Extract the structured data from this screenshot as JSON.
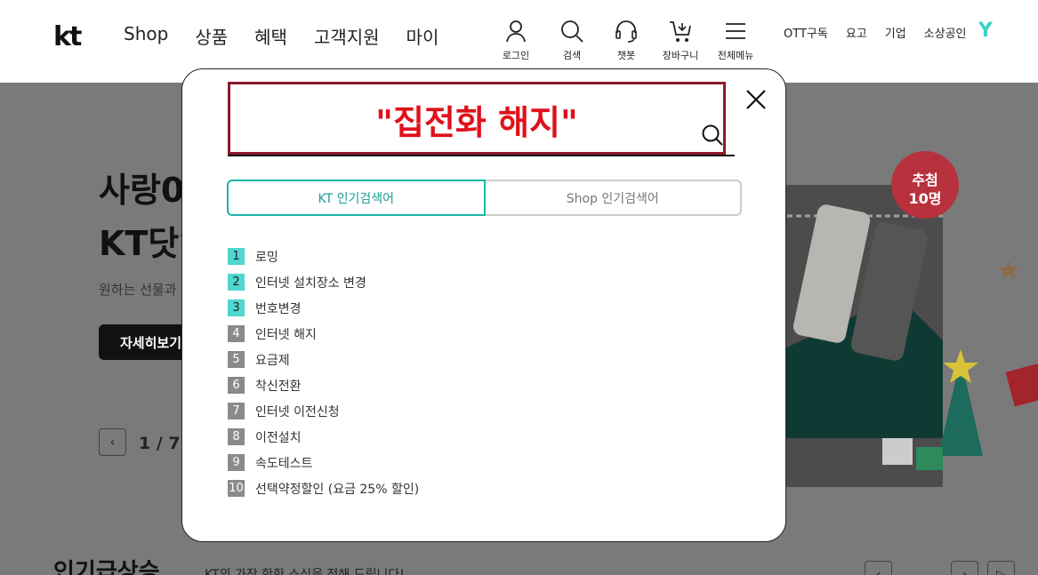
{
  "header": {
    "logo": "kt",
    "gnb": [
      "Shop",
      "상품",
      "혜택",
      "고객지원",
      "마이"
    ],
    "utils": [
      {
        "label": "로그인",
        "icon": "user-icon"
      },
      {
        "label": "검색",
        "icon": "search-icon"
      },
      {
        "label": "챗봇",
        "icon": "headset-icon"
      },
      {
        "label": "장바구니",
        "icon": "cart-icon"
      },
      {
        "label": "전체메뉴",
        "icon": "menu-icon"
      }
    ],
    "toplinks": [
      "OTT구독",
      "요고",
      "기업",
      "소상공인"
    ],
    "y_logo": "Y"
  },
  "background": {
    "hero_line1": "사랑0",
    "hero_line2": "KT닷컴",
    "hero_sub": "원하는 선물과",
    "hero_btn": "자세히보기",
    "pager": "1 / 7",
    "bottom_title": "인기급상승",
    "bottom_sub": "KT의 가장 핫한 소식을 전해 드립니다!",
    "promo_badge_line1": "추첨",
    "promo_badge_line2": "10명"
  },
  "modal": {
    "search_query": "\"집전화 해지\"",
    "tabs": [
      "KT 인기검색어",
      "Shop 인기검색어"
    ],
    "ranks": [
      {
        "n": "1",
        "text": "로밍"
      },
      {
        "n": "2",
        "text": "인터넷 설치장소 변경"
      },
      {
        "n": "3",
        "text": "번호변경"
      },
      {
        "n": "4",
        "text": "인터넷 해지"
      },
      {
        "n": "5",
        "text": "요금제"
      },
      {
        "n": "6",
        "text": "착신전환"
      },
      {
        "n": "7",
        "text": "인터넷 이전신청"
      },
      {
        "n": "8",
        "text": "이전설치"
      },
      {
        "n": "9",
        "text": "속도테스트"
      },
      {
        "n": "10",
        "text": "선택약정할인 (요금 25% 할인)"
      }
    ]
  },
  "colors": {
    "accent": "#1ab6a8",
    "rank_top": "#4fd6cf",
    "rank_rest": "#8a8a8a",
    "highlight_border": "#8b1a2b",
    "highlight_text": "#e0101a"
  }
}
